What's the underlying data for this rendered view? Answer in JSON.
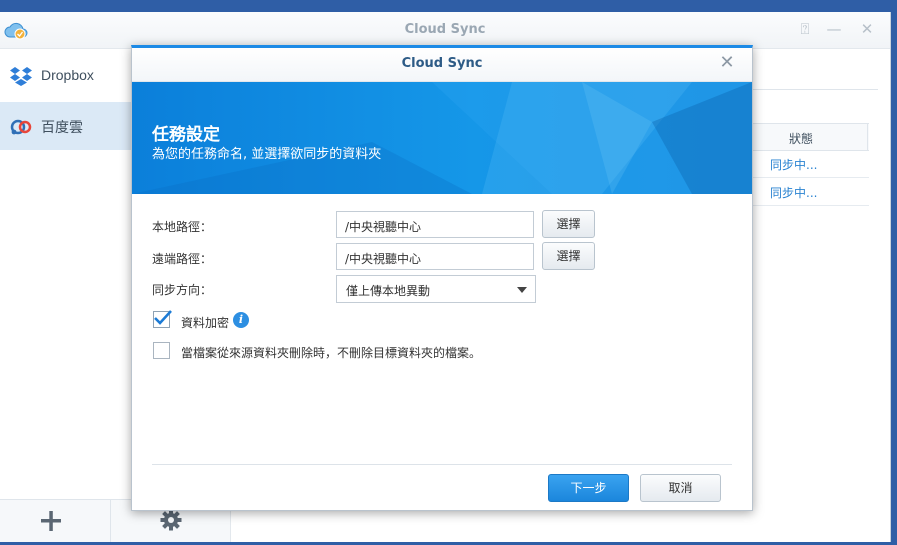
{
  "app": {
    "title": "Cloud Sync",
    "window_controls": {
      "pin": "⍰",
      "minimize": "—",
      "close": "✕"
    }
  },
  "sidebar": {
    "items": [
      {
        "label": "Dropbox",
        "icon": "dropbox-icon"
      },
      {
        "label": "百度雲",
        "icon": "baidu-cloud-icon"
      }
    ],
    "footer": {
      "add_icon": "plus-icon",
      "settings_icon": "gear-icon"
    }
  },
  "background_table": {
    "header_status": "狀態",
    "rows": [
      {
        "status": "同步中..."
      },
      {
        "status": "同步中..."
      }
    ]
  },
  "dialog": {
    "title": "Cloud Sync",
    "close_icon": "close-icon",
    "banner": {
      "title": "任務設定",
      "subtitle": "為您的任務命名, 並選擇欲同步的資料夾"
    },
    "form": {
      "local_path_label": "本地路徑：",
      "local_path_value": "/中央視聽中心",
      "remote_path_label": "遠端路徑：",
      "remote_path_value": "/中央視聽中心",
      "choose_label": "選擇",
      "sync_direction_label": "同步方向：",
      "sync_direction_value": "僅上傳本地異動",
      "encrypt_label": "資料加密",
      "encrypt_checked": true,
      "keep_deleted_label": "當檔案從來源資料夾刪除時，不刪除目標資料夾的檔案。",
      "keep_deleted_checked": false
    },
    "buttons": {
      "next": "下一步",
      "cancel": "取消"
    }
  },
  "colors": {
    "accent": "#1c8ae6",
    "banner": "#0b7fda",
    "status_text": "#2a83d1"
  }
}
